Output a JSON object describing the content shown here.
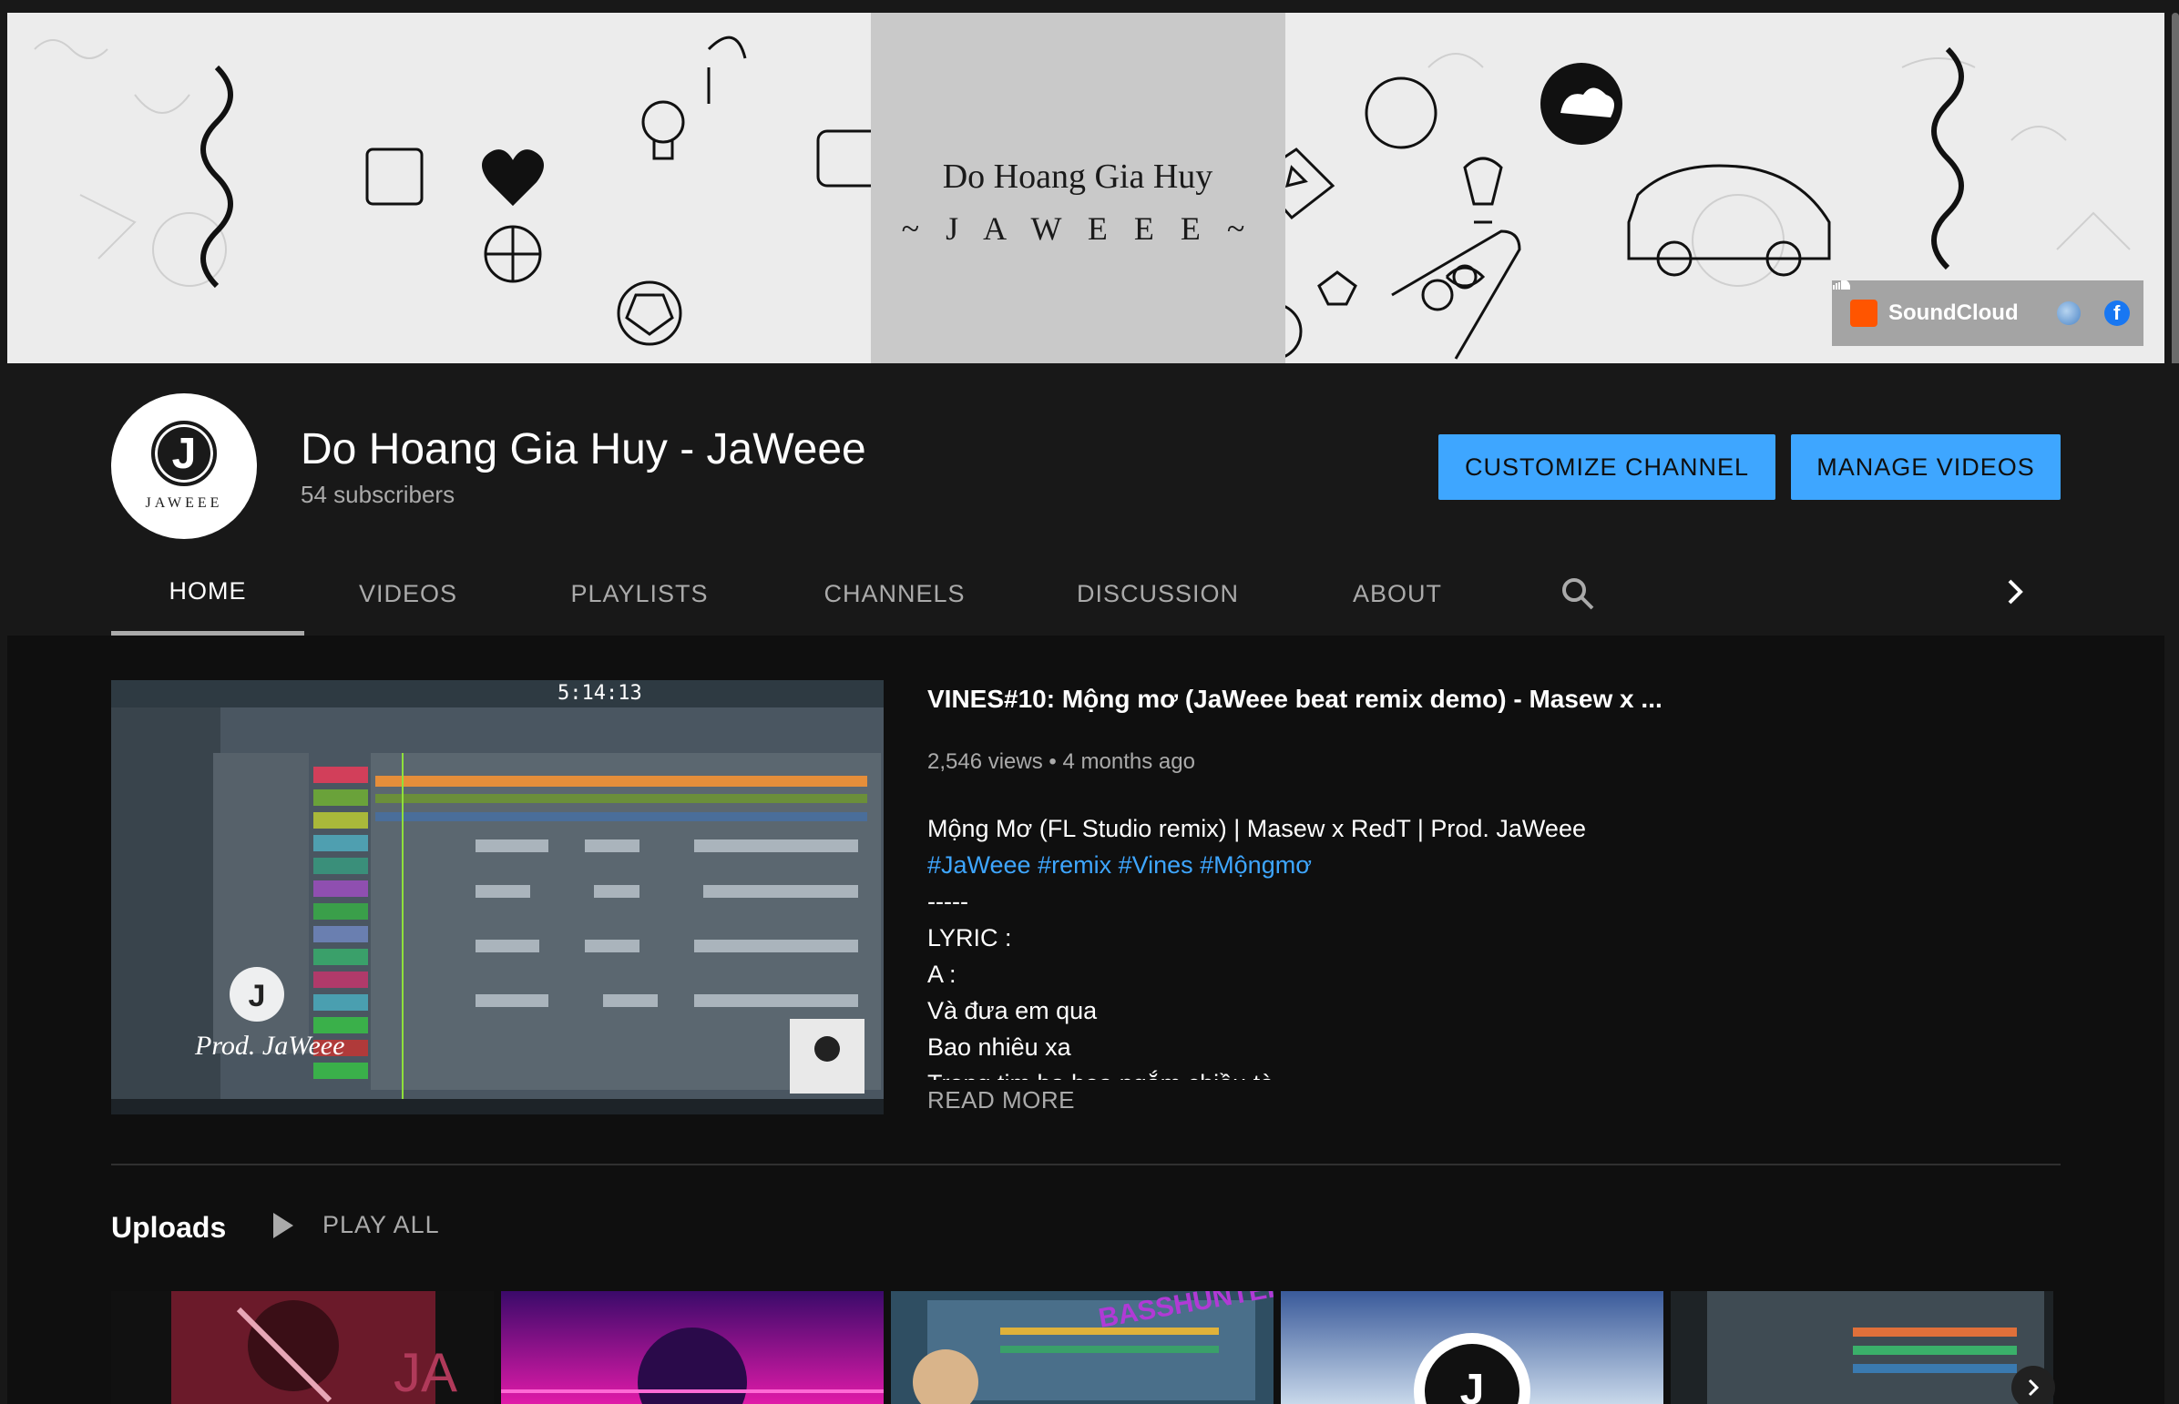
{
  "banner": {
    "name": "Do Hoang Gia Huy",
    "tagline": "~ J A W E E E ~",
    "links": {
      "soundcloud": "SoundCloud",
      "facebook": "f"
    }
  },
  "channel": {
    "avatar_text": "JAWEEE",
    "avatar_letter": "J",
    "title": "Do Hoang Gia Huy - JaWeee",
    "subscribers": "54 subscribers"
  },
  "actions": {
    "customize": "CUSTOMIZE CHANNEL",
    "manage": "MANAGE VIDEOS"
  },
  "tabs": [
    "HOME",
    "VIDEOS",
    "PLAYLISTS",
    "CHANNELS",
    "DISCUSSION",
    "ABOUT"
  ],
  "featured": {
    "title": "VINES#10: Mộng mơ (JaWeee beat remix demo) - Masew x ...",
    "views": "2,546 views",
    "age": "4 months ago",
    "desc_line1": "Mộng Mơ (FL Studio remix) | Masew x RedT | Prod. JaWeee",
    "desc_tags": "#JaWeee #remix #Vines #Mộngmơ",
    "desc_sep": "-----",
    "desc_lyric": "LYRIC :",
    "desc_a": "A :",
    "desc_l1": "Và đưa em qua",
    "desc_l2": "Bao nhiêu xa",
    "desc_l3": "Trong tim ba hoa ngắm chiều tà",
    "read_more": "READ MORE",
    "thumb_signature": "Prod. JaWeee",
    "thumb_time": "5:14:13"
  },
  "uploads": {
    "title": "Uploads",
    "play_all": "PLAY ALL"
  },
  "colors": {
    "accent": "#3ea6ff",
    "bg": "#181818",
    "content_bg": "#0f0f0f"
  }
}
